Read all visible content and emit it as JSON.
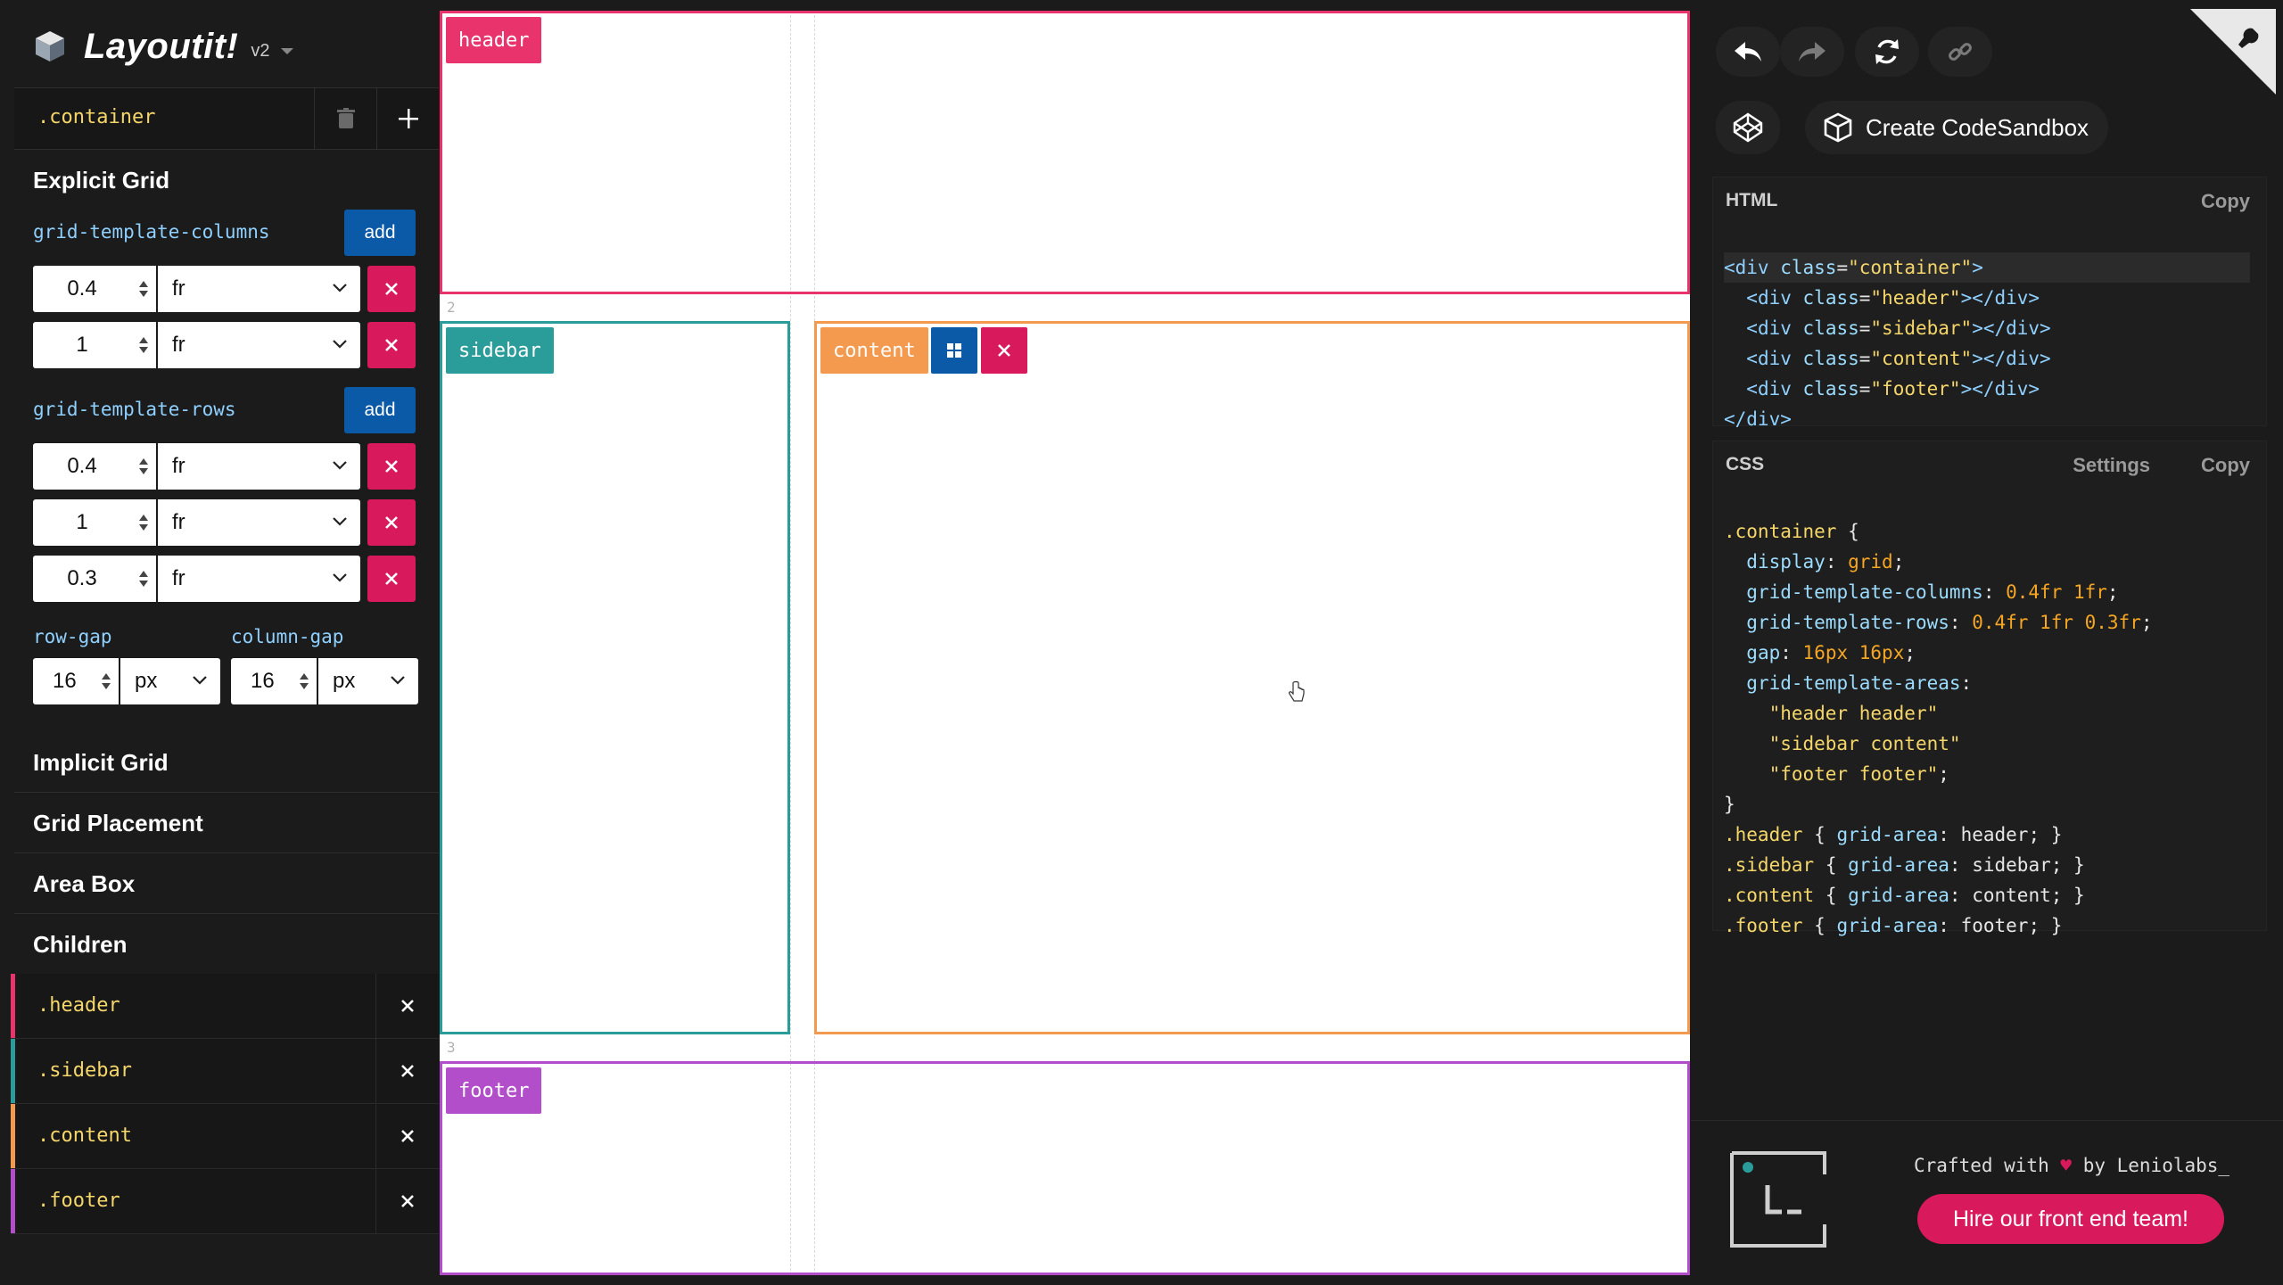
{
  "app": {
    "title": "Layoutit!",
    "version": "v2"
  },
  "container": {
    "name": ".container"
  },
  "explicit_grid": {
    "title": "Explicit Grid",
    "columns_label": "grid-template-columns",
    "rows_label": "grid-template-rows",
    "add_label": "add",
    "columns": [
      {
        "value": "0.4",
        "unit": "fr"
      },
      {
        "value": "1",
        "unit": "fr"
      }
    ],
    "rows": [
      {
        "value": "0.4",
        "unit": "fr"
      },
      {
        "value": "1",
        "unit": "fr"
      },
      {
        "value": "0.3",
        "unit": "fr"
      }
    ],
    "row_gap": {
      "label": "row-gap",
      "value": "16",
      "unit": "px"
    },
    "column_gap": {
      "label": "column-gap",
      "value": "16",
      "unit": "px"
    }
  },
  "sections": {
    "implicit": "Implicit Grid",
    "placement": "Grid Placement",
    "area_box": "Area Box",
    "children": "Children"
  },
  "children": [
    {
      "name": ".header",
      "color": "#e8336d"
    },
    {
      "name": ".sidebar",
      "color": "#2a9d9a"
    },
    {
      "name": ".content",
      "color": "#f39a4e"
    },
    {
      "name": ".footer",
      "color": "#b24ec9"
    }
  ],
  "canvas": {
    "areas": {
      "header": "header",
      "sidebar": "sidebar",
      "content": "content",
      "footer": "footer"
    },
    "row_numbers": [
      "2",
      "3"
    ]
  },
  "right": {
    "codesandbox_label": "Create CodeSandbox",
    "html_title": "HTML",
    "css_title": "CSS",
    "copy_label": "Copy",
    "settings_label": "Settings",
    "crafted_prefix": "Crafted with",
    "heart": "♥",
    "crafted_suffix": "by Leniolabs_",
    "hire_label": "Hire our front end team!"
  },
  "colors": {
    "header": "#e8336d",
    "sidebar": "#2a9d9a",
    "content": "#f39a4e",
    "footer": "#b24ec9",
    "accent_blue": "#0b5aa8",
    "danger": "#d8195b"
  }
}
